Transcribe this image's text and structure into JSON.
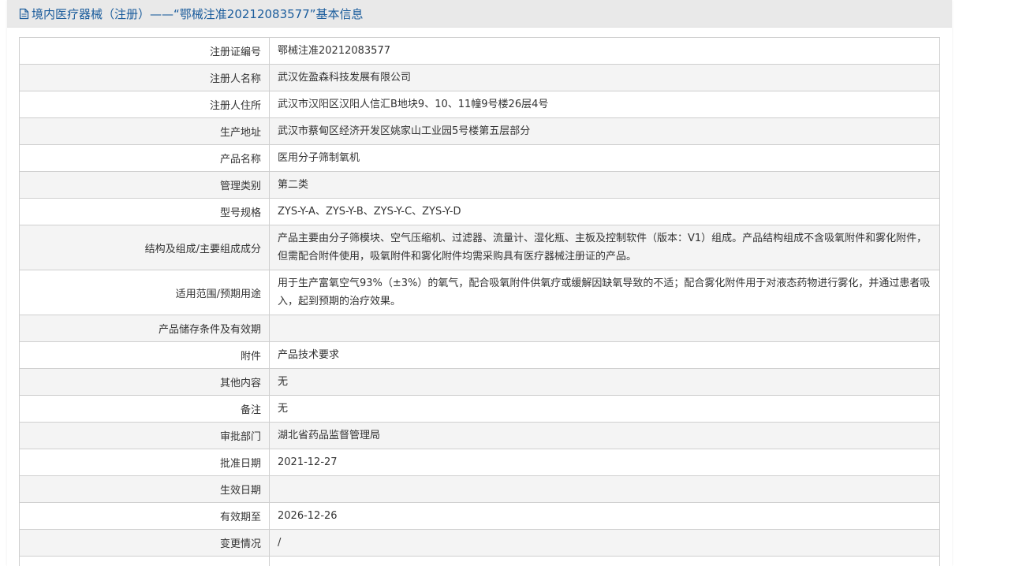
{
  "header": {
    "title": "境内医疗器械（注册）——“鄂械注准20212083577”基本信息",
    "icon": "document-icon"
  },
  "rows": [
    {
      "label": "注册证编号",
      "value": "鄂械注准20212083577"
    },
    {
      "label": "注册人名称",
      "value": "武汉佐盈森科技发展有限公司"
    },
    {
      "label": "注册人住所",
      "value": "武汉市汉阳区汉阳人信汇B地块9、10、11幢9号楼26层4号"
    },
    {
      "label": "生产地址",
      "value": "武汉市蔡甸区经济开发区姚家山工业园5号楼第五层部分"
    },
    {
      "label": "产品名称",
      "value": "医用分子筛制氧机"
    },
    {
      "label": "管理类别",
      "value": "第二类"
    },
    {
      "label": "型号规格",
      "value": "ZYS-Y-A、ZYS-Y-B、ZYS-Y-C、ZYS-Y-D"
    },
    {
      "label": "结构及组成/主要组成成分",
      "value": "产品主要由分子筛模块、空气压缩机、过滤器、流量计、湿化瓶、主板及控制软件（版本：V1）组成。产品结构组成不含吸氧附件和雾化附件，但需配合附件使用，吸氧附件和雾化附件均需采购具有医疗器械注册证的产品。"
    },
    {
      "label": "适用范围/预期用途",
      "value": "用于生产富氧空气93%（±3%）的氧气，配合吸氧附件供氧疗或缓解因缺氧导致的不适；配合雾化附件用于对液态药物进行雾化，并通过患者吸入，起到预期的治疗效果。"
    },
    {
      "label": "产品储存条件及有效期",
      "value": ""
    },
    {
      "label": "附件",
      "value": "产品技术要求"
    },
    {
      "label": "其他内容",
      "value": "无"
    },
    {
      "label": "备注",
      "value": "无"
    },
    {
      "label": "审批部门",
      "value": "湖北省药品监督管理局"
    },
    {
      "label": "批准日期",
      "value": "2021-12-27"
    },
    {
      "label": "生效日期",
      "value": ""
    },
    {
      "label": "有效期至",
      "value": "2026-12-26"
    },
    {
      "label": "变更情况",
      "value": "/"
    }
  ],
  "colors": {
    "header_text": "#1a5c9c",
    "header_bg": "#e9e9e9",
    "row_alt_bg": "#f4f4f4",
    "border": "#cfcfcf",
    "text": "#333333"
  }
}
